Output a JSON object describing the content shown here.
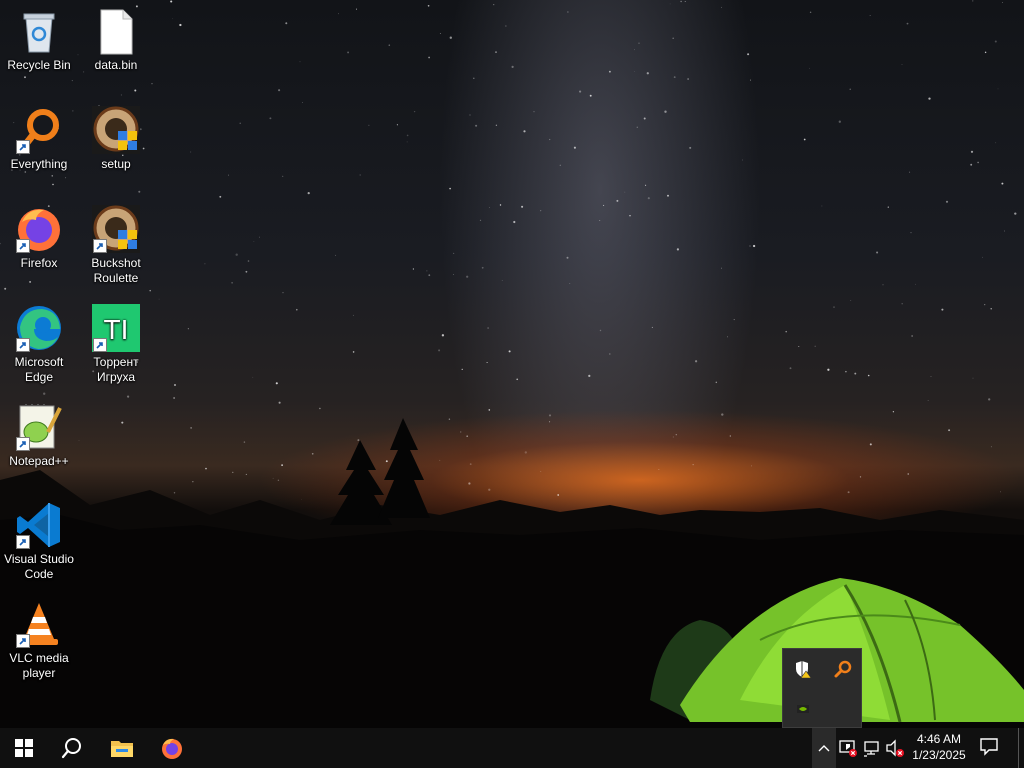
{
  "desktop_icons": [
    {
      "label": "Recycle Bin",
      "icon": "recycle-bin-icon"
    },
    {
      "label": "data.bin",
      "icon": "file-icon"
    },
    {
      "label": "Everything",
      "icon": "everything-search-icon"
    },
    {
      "label": "setup",
      "icon": "setup-icon"
    },
    {
      "label": "Firefox",
      "icon": "firefox-icon"
    },
    {
      "label": "Buckshot Roulette",
      "icon": "buckshot-roulette-icon"
    },
    {
      "label": "Microsoft Edge",
      "icon": "edge-icon"
    },
    {
      "label": "Торрент Игруха",
      "icon": "torrent-igruha-icon"
    },
    {
      "label": "Notepad++",
      "icon": "notepad-plus-plus-icon"
    },
    {
      "label": "Visual Studio Code",
      "icon": "vscode-icon"
    },
    {
      "label": "VLC media player",
      "icon": "vlc-icon"
    }
  ],
  "tray_overflow": {
    "items": [
      "windows-security-warning-icon",
      "everything-tray-icon",
      "nvidia-icon"
    ]
  },
  "taskbar": {
    "pinned": [
      "start-icon",
      "search-icon",
      "file-explorer-icon",
      "firefox-icon"
    ],
    "tray": [
      "show-hidden-icons-chevron",
      "defender-icon",
      "network-icon",
      "volume-muted-icon"
    ],
    "clock": {
      "time": "4:46 AM",
      "date": "1/23/2025"
    },
    "notification_icon": "action-center-icon"
  },
  "colors": {
    "taskbar_bg": "#101010",
    "tent_green": "#7ed321",
    "sunset_orange": "#e8702a"
  }
}
